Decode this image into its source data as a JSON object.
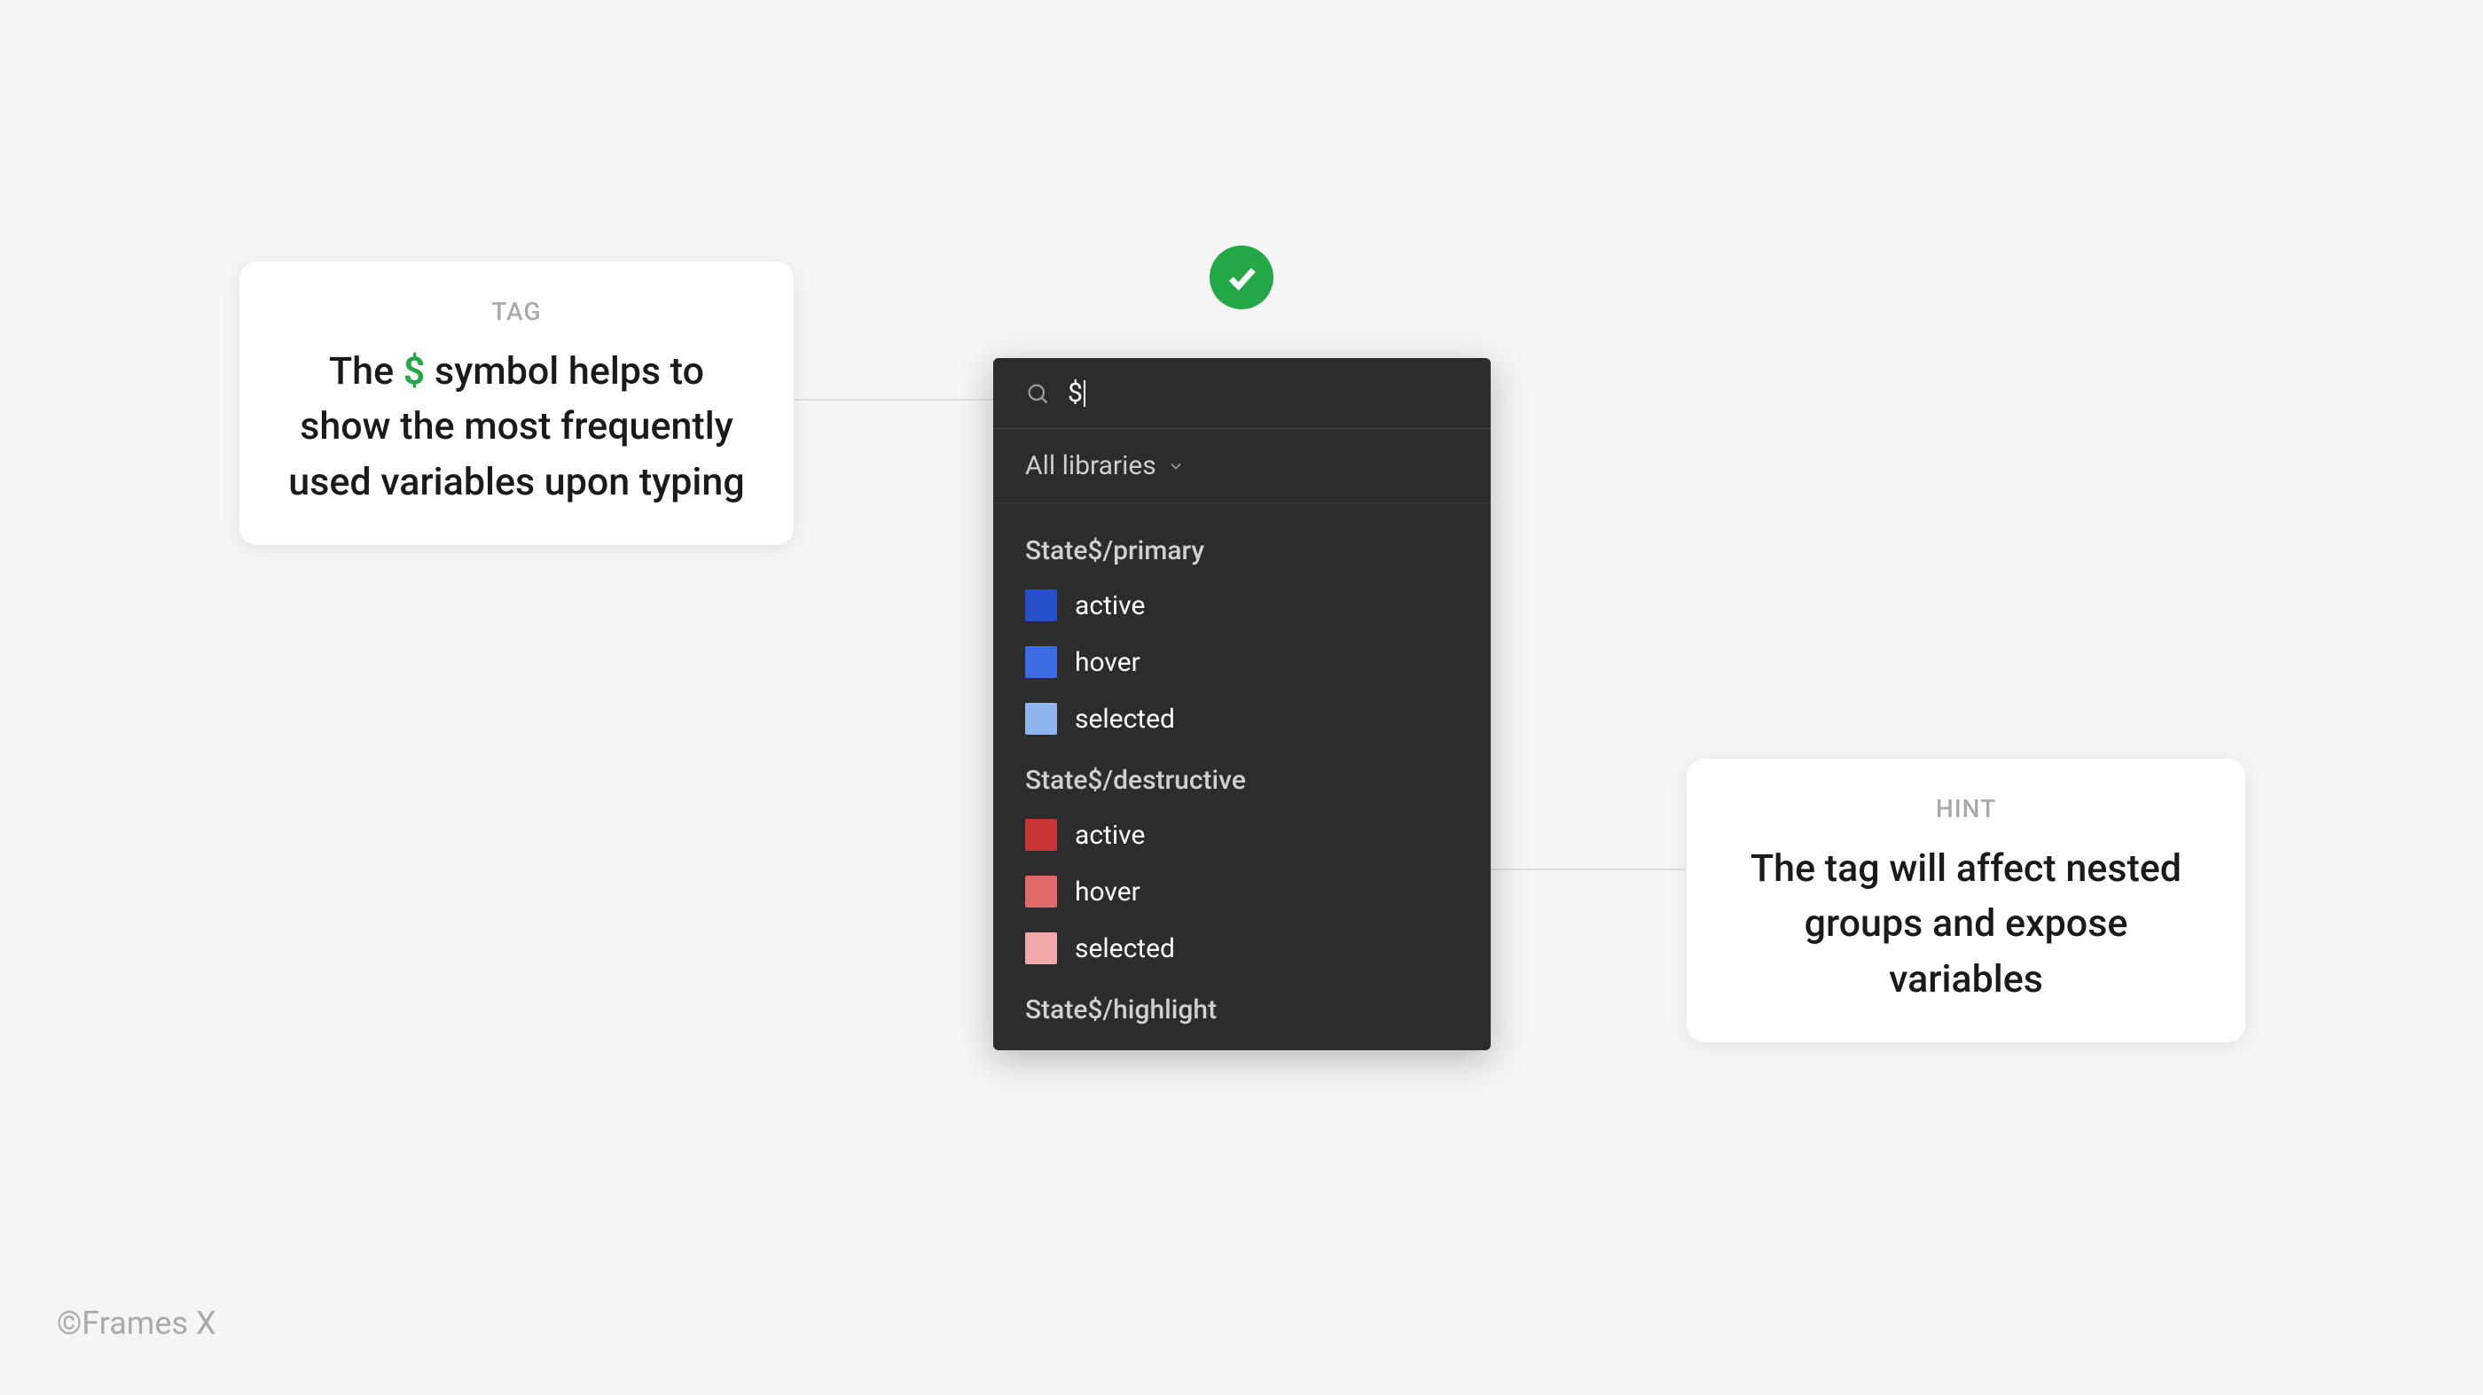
{
  "tooltips": {
    "left": {
      "label": "TAG",
      "text_before": "The ",
      "text_highlight": "$",
      "text_after": " symbol helps to show the most frequently used variables upon typing"
    },
    "right": {
      "label": "HINT",
      "text": "The tag will affect nested groups and expose variables"
    }
  },
  "search": {
    "query": "$",
    "libraries_label": "All libraries"
  },
  "groups": [
    {
      "name": "State$/primary",
      "items": [
        {
          "label": "active",
          "color": "#2450c9"
        },
        {
          "label": "hover",
          "color": "#3d6ce3"
        },
        {
          "label": "selected",
          "color": "#8fb5ef"
        }
      ]
    },
    {
      "name": "State$/destructive",
      "items": [
        {
          "label": "active",
          "color": "#c93434"
        },
        {
          "label": "hover",
          "color": "#e36a6a"
        },
        {
          "label": "selected",
          "color": "#f0a8a8"
        }
      ]
    },
    {
      "name": "State$/highlight",
      "items": []
    }
  ],
  "footer": "©Frames X"
}
